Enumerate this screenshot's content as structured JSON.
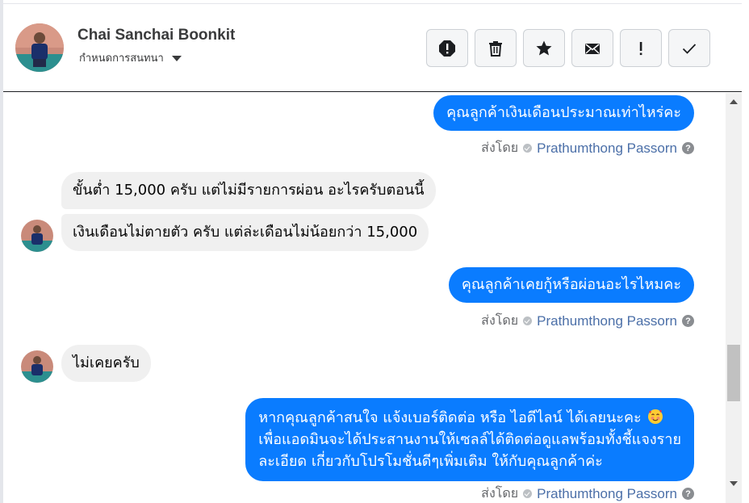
{
  "header": {
    "contact_name": "Chai Sanchai Boonkit",
    "assign_label": "กำหนดการสนทนา",
    "toolbar": [
      {
        "icon": "alert-circle-icon",
        "name": "spam-button"
      },
      {
        "icon": "trash-icon",
        "name": "delete-button"
      },
      {
        "icon": "star-icon",
        "name": "star-button"
      },
      {
        "icon": "envelope-icon",
        "name": "mark-unread-button"
      },
      {
        "icon": "exclamation-icon",
        "name": "follow-up-button"
      },
      {
        "icon": "checkmark-icon",
        "name": "done-button"
      }
    ]
  },
  "messages": [
    {
      "direction": "outgoing",
      "text": "คุณลูกค้าเงินเดือนประมาณเท่าไหร่คะ"
    },
    {
      "direction": "incoming",
      "text": "ขั้นต่ำ 15,000 ครับ แต่ไม่มีรายการผ่อน อะไรครับตอนนี้"
    },
    {
      "direction": "incoming",
      "text": "เงินเดือนไม่ตายตัว ครับ แต่ล่ะเดือนไม่น้อยกว่า 15,000"
    },
    {
      "direction": "outgoing",
      "text": "คุณลูกค้าเคยกู้หรือผ่อนอะไรไหมคะ"
    },
    {
      "direction": "incoming",
      "text": "ไม่เคยครับ"
    },
    {
      "direction": "outgoing",
      "lines": [
        "หากคุณลูกค้าสนใจ แจ้งเบอร์ติดต่อ หรือ ไอดีไลน์ ได้เลยนะคะ",
        "เพื่อแอดมินจะได้ประสานงานให้เซลล์ได้ติดต่อดูแลพร้อมทั้งชี้แจงราย",
        "ละเอียด เกี่ยวกับโปรโมชั่นดีๆเพิ่มเติม ให้กับคุณลูกค้าค่ะ"
      ],
      "emoji": "smiling-face-with-hearts-icon"
    }
  ],
  "sent_by": {
    "label": "ส่งโดย",
    "agent": "Prathumthong Passorn"
  },
  "colors": {
    "outgoing_bubble": "#0a7cff",
    "incoming_bubble": "#f0f0f0",
    "agent_link": "#4b6fa8"
  }
}
